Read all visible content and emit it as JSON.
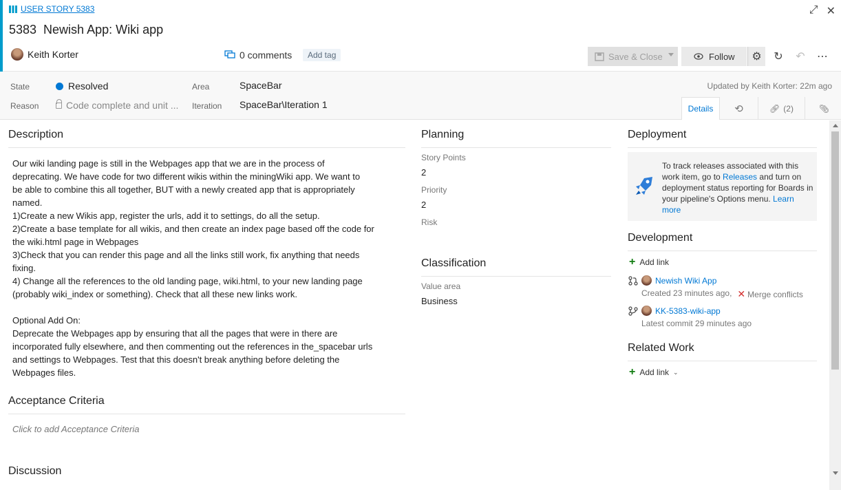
{
  "header": {
    "type_label": "USER STORY 5383",
    "id": "5383",
    "title": "Newish App: Wiki app",
    "assignee": "Keith Korter",
    "comments": "0 comments",
    "add_tag": "Add tag",
    "save_close": "Save & Close",
    "follow": "Follow"
  },
  "fields": {
    "state_label": "State",
    "state_value": "Resolved",
    "reason_label": "Reason",
    "reason_value": "Code complete and unit ...",
    "area_label": "Area",
    "area_value": "SpaceBar",
    "iteration_label": "Iteration",
    "iteration_value": "SpaceBar\\Iteration 1",
    "updated": "Updated by Keith Korter: 22m ago",
    "state_color": "#0078d4"
  },
  "tabs": {
    "details": "Details",
    "links": "(2)"
  },
  "description": {
    "title": "Description",
    "lines": [
      "Our wiki landing page is still in the Webpages app that we are in the process of",
      "deprecating. We have code for two different wikis within the miningWiki app. We want to",
      "be able to combine this all together, BUT with a newly created app that is appropriately",
      "named.",
      "1)Create a new Wikis app, register the urls, add it to settings, do all the setup.",
      "2)Create a base template for all wikis, and then create an index page based off the code for",
      "the wiki.html page in Webpages",
      "3)Check that you can render this page and all the links still work, fix anything that needs",
      "fixing.",
      "4) Change all the references to the old landing page, wiki.html, to your new landing page",
      "(probably wiki_index or something). Check that all these new links work.",
      "",
      "Optional Add On:",
      "Deprecate the Webpages app by ensuring that all the pages that were in there are",
      "incorporated fully elsewhere, and then commenting out the references in the_spacebar urls",
      "and settings to Webpages. Test that this doesn't break anything before deleting the",
      "Webpages files."
    ]
  },
  "acceptance": {
    "title": "Acceptance Criteria",
    "placeholder": "Click to add Acceptance Criteria"
  },
  "discussion": {
    "title": "Discussion"
  },
  "planning": {
    "title": "Planning",
    "story_points_label": "Story Points",
    "story_points": "2",
    "priority_label": "Priority",
    "priority": "2",
    "risk_label": "Risk"
  },
  "classification": {
    "title": "Classification",
    "value_area_label": "Value area",
    "value_area": "Business"
  },
  "deployment": {
    "title": "Deployment",
    "text_pre": "To track releases associated with this work item, go to ",
    "releases_link": "Releases",
    "text_mid": " and turn on deployment status reporting for Boards in your pipeline's Options menu. ",
    "learn_more": "Learn more"
  },
  "development": {
    "title": "Development",
    "add_link": "Add link",
    "items": [
      {
        "name": "Newish Wiki App",
        "meta": "Created 23 minutes ago,",
        "status": "Merge conflicts"
      },
      {
        "name": "KK-5383-wiki-app",
        "meta": "Latest commit 29 minutes ago"
      }
    ]
  },
  "related": {
    "title": "Related Work",
    "add_link": "Add link"
  }
}
